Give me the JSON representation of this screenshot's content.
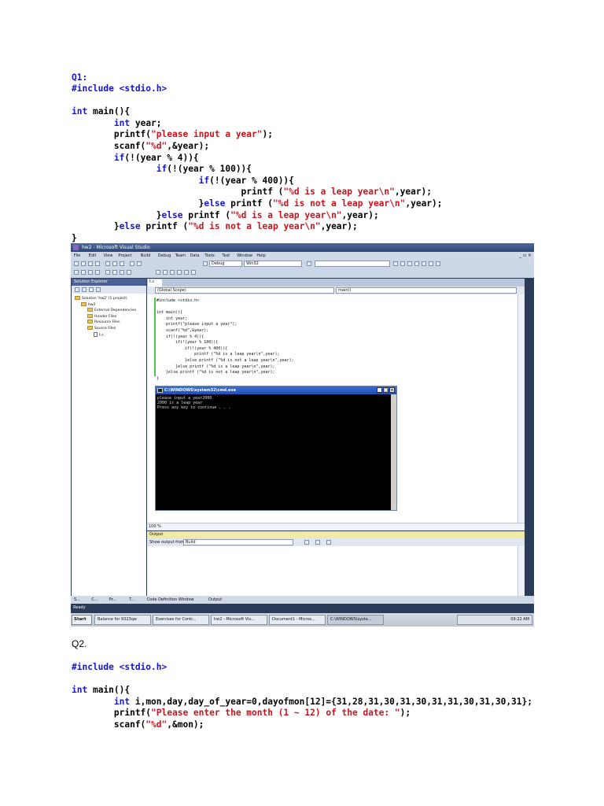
{
  "q1": {
    "heading": "Q1:",
    "code_lines": [
      [
        {
          "t": "#include <stdio.h>",
          "c": "blue"
        }
      ],
      [],
      [
        {
          "t": "int",
          "c": "blue"
        },
        {
          "t": " main(){"
        }
      ],
      [
        {
          "t": "        "
        },
        {
          "t": "int",
          "c": "blue"
        },
        {
          "t": " year;"
        }
      ],
      [
        {
          "t": "        printf("
        },
        {
          "t": "\"please input a year\"",
          "c": "red"
        },
        {
          "t": ");"
        }
      ],
      [
        {
          "t": "        scanf("
        },
        {
          "t": "\"%d\"",
          "c": "red"
        },
        {
          "t": ",&year);"
        }
      ],
      [
        {
          "t": "        "
        },
        {
          "t": "if",
          "c": "blue"
        },
        {
          "t": "(!(year % 4)){"
        }
      ],
      [
        {
          "t": "                "
        },
        {
          "t": "if",
          "c": "blue"
        },
        {
          "t": "(!(year % 100)){"
        }
      ],
      [
        {
          "t": "                        "
        },
        {
          "t": "if",
          "c": "blue"
        },
        {
          "t": "(!(year % 400)){"
        }
      ],
      [
        {
          "t": "                                printf ("
        },
        {
          "t": "\"%d is a leap year\\n\"",
          "c": "red"
        },
        {
          "t": ",year);"
        }
      ],
      [
        {
          "t": "                        }"
        },
        {
          "t": "else",
          "c": "blue"
        },
        {
          "t": " printf ("
        },
        {
          "t": "\"%d is not a leap year\\n\"",
          "c": "red"
        },
        {
          "t": ",year);"
        }
      ],
      [
        {
          "t": "                }"
        },
        {
          "t": "else",
          "c": "blue"
        },
        {
          "t": " printf ("
        },
        {
          "t": "\"%d is a leap year\\n\"",
          "c": "red"
        },
        {
          "t": ",year);"
        }
      ],
      [
        {
          "t": "        }"
        },
        {
          "t": "else",
          "c": "blue"
        },
        {
          "t": " printf ("
        },
        {
          "t": "\"%d is not a leap year\\n\"",
          "c": "red"
        },
        {
          "t": ",year);"
        }
      ],
      [
        {
          "t": "}"
        }
      ]
    ]
  },
  "vs": {
    "title": "hw2 - Microsoft Visual Studio",
    "menu": [
      "File",
      "Edit",
      "View",
      "Project",
      "Build",
      "Debug",
      "Team",
      "Data",
      "Tools",
      "Test",
      "Window",
      "Help"
    ],
    "config_combo": "Debug",
    "platform_combo": "Win32",
    "solution_panel_title": "Solution Explorer",
    "tree": [
      {
        "label": "Solution 'hw2' (1 project)",
        "indent": 0,
        "icon": "solution"
      },
      {
        "label": "hw2",
        "indent": 1,
        "icon": "project"
      },
      {
        "label": "External Dependencies",
        "indent": 2,
        "icon": "folder"
      },
      {
        "label": "Header Files",
        "indent": 2,
        "icon": "folder"
      },
      {
        "label": "Resource Files",
        "indent": 2,
        "icon": "folder"
      },
      {
        "label": "Source Files",
        "indent": 2,
        "icon": "folder"
      },
      {
        "label": "t.c",
        "indent": 3,
        "icon": "file"
      }
    ],
    "editor_tab": "t.c",
    "scope_left": "(Global Scope)",
    "scope_right": "main()",
    "editor_code": "#include <stdio.h>\n\nint main(){\n    int year;\n    printf(\"please input a year\");\n    scanf(\"%d\",&year);\n    if(!(year % 4)){\n        if(!(year % 100)){\n            if(!(year % 400)){\n                printf (\"%d is a leap year\\n\",year);\n            }else printf (\"%d is not a leap year\\n\",year);\n        }else printf (\"%d is a leap year\\n\",year);\n    }else printf (\"%d is not a leap year\\n\",year);\n}",
    "cmd_title": "C:\\WINDOWS\\system32\\cmd.exe",
    "cmd_output": "please input a year2000\n2000 is a leap year\nPress any key to continue . . .",
    "zoom": "100 %",
    "output_title": "Output",
    "output_show_label": "Show output from:",
    "output_show_value": "Build",
    "bottom_tabs": [
      "S...",
      "C...",
      "Pr...",
      "T...",
      "Code Definition Window",
      "Output"
    ],
    "status": "Ready",
    "taskbar": {
      "start": "Start",
      "tasks": [
        "Balance for 9323qw",
        "Exercises for Contr...",
        "hw2 - Microsoft Vis...",
        "Document1 - Micros...",
        "C:\\WINDOWS\\syste..."
      ],
      "clock": "09:22 AM"
    }
  },
  "q2": {
    "heading": "Q2.",
    "code_lines": [
      [
        {
          "t": "#include <stdio.h>",
          "c": "blue"
        }
      ],
      [],
      [
        {
          "t": "int",
          "c": "blue"
        },
        {
          "t": " main(){"
        }
      ],
      [
        {
          "t": "        "
        },
        {
          "t": "int",
          "c": "blue"
        },
        {
          "t": " i,mon,day,day_of_year=0,dayofmon[12]={31,28,31,30,31,30,31,31,30,31,30,31};"
        }
      ],
      [
        {
          "t": "        printf("
        },
        {
          "t": "\"Please enter the month (1 ~ 12) of the date: \"",
          "c": "red"
        },
        {
          "t": ");"
        }
      ],
      [
        {
          "t": "        scanf("
        },
        {
          "t": "\"%d\"",
          "c": "red"
        },
        {
          "t": ",&mon);"
        }
      ]
    ]
  }
}
